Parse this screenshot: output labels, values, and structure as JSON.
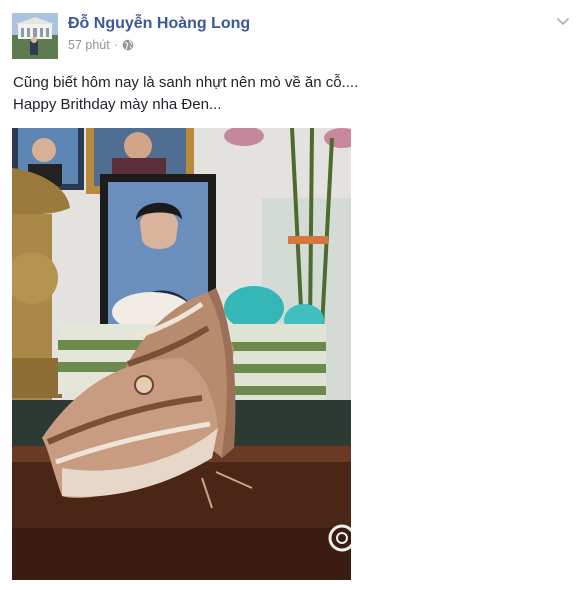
{
  "post": {
    "author": "Đỗ Nguyễn Hoàng Long",
    "timestamp": "57 phút",
    "separator": "·",
    "privacy_icon": "globe-icon",
    "menu_icon": "chevron-down-icon",
    "text_lines": [
      "Cũng biết hôm nay là sanh nhựt nên mò về ăn cỗ....",
      "Happy Brithday mày nha Đen..."
    ],
    "photo_subject": "butterfly-on-altar-photo"
  },
  "colors": {
    "author_link": "#3b5998",
    "meta_text": "#90949c",
    "body_text": "#1d2129"
  }
}
